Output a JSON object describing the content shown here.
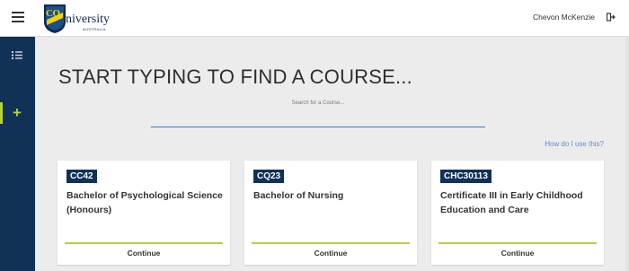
{
  "header": {
    "logo_text": "niversity",
    "logo_cq": "CQ",
    "logo_sub": "AUSTRALIA",
    "username": "Chevon McKenzie"
  },
  "main": {
    "title": "START TYPING TO FIND A COURSE...",
    "search": {
      "label": "Search for a Course...",
      "value": ""
    },
    "help_link": "How do I use this?"
  },
  "cards": [
    {
      "code": "CC42",
      "title": "Bachelor of Psychological Science (Honours)",
      "action": "Continue"
    },
    {
      "code": "CQ23",
      "title": "Bachelor of Nursing",
      "action": "Continue"
    },
    {
      "code": "CHC30113",
      "title": "Certificate III in Early Childhood Education and Care",
      "action": "Continue"
    }
  ],
  "colors": {
    "brand_navy": "#113156",
    "accent_green": "#b8d233",
    "link_blue": "#5a8cd6"
  }
}
